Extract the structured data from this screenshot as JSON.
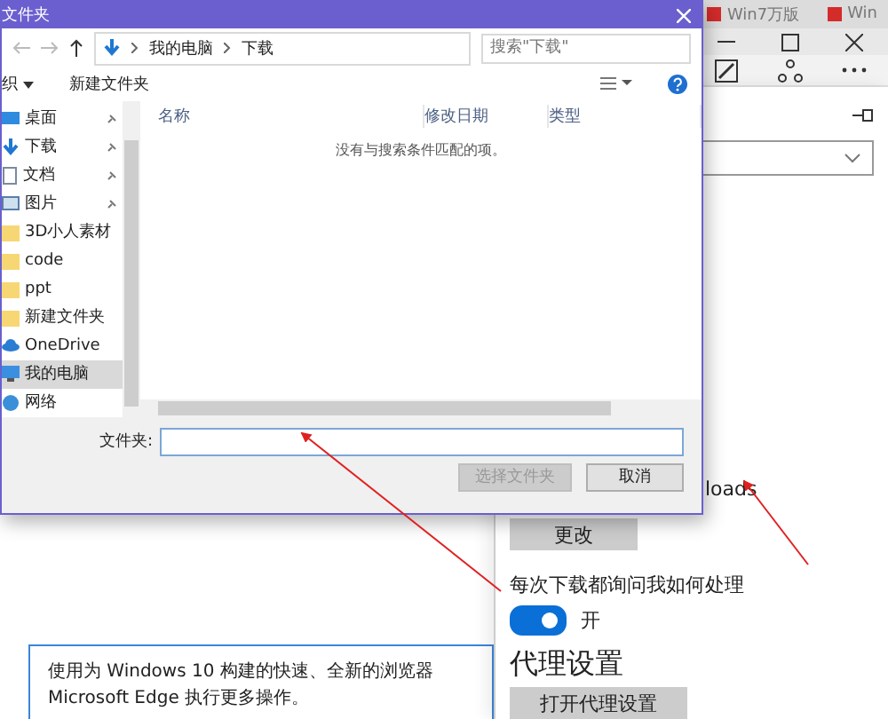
{
  "browser_tabs": [
    {
      "label": "Win7万版"
    },
    {
      "label": "Win"
    }
  ],
  "settings": {
    "path_fragment": "loads",
    "change_button": "更改",
    "ask_label": "每次下载都询问我如何处理",
    "ask_toggle": {
      "on": true,
      "label": "开"
    },
    "proxy_heading": "代理设置",
    "proxy_button": "打开代理设置"
  },
  "banner": "使用为 Windows 10 构建的快速、全新的浏览器 Microsoft Edge 执行更多操作。",
  "dialog": {
    "title": "文件夹",
    "breadcrumb": [
      "我的电脑",
      "下载"
    ],
    "search": {
      "placeholder": "搜索\"下载\""
    },
    "toolbar": {
      "organize": "织",
      "new_folder": "新建文件夹"
    },
    "nav": [
      {
        "label": "桌面",
        "kind": "desktop",
        "pinned": true,
        "selected": false
      },
      {
        "label": "下载",
        "kind": "download",
        "pinned": true,
        "selected": false
      },
      {
        "label": "文档",
        "kind": "document",
        "pinned": true,
        "selected": false
      },
      {
        "label": "图片",
        "kind": "picture",
        "pinned": true,
        "selected": false
      },
      {
        "label": "3D小人素材",
        "kind": "folder",
        "pinned": false,
        "selected": false
      },
      {
        "label": "code",
        "kind": "folder",
        "pinned": false,
        "selected": false
      },
      {
        "label": "ppt",
        "kind": "folder",
        "pinned": false,
        "selected": false
      },
      {
        "label": "新建文件夹",
        "kind": "folder",
        "pinned": false,
        "selected": false
      },
      {
        "label": "OneDrive",
        "kind": "cloud",
        "pinned": false,
        "selected": false
      },
      {
        "label": "我的电脑",
        "kind": "computer",
        "pinned": false,
        "selected": true
      },
      {
        "label": "网络",
        "kind": "network",
        "pinned": false,
        "selected": false
      }
    ],
    "columns": [
      "名称",
      "修改日期",
      "类型"
    ],
    "empty_message": "没有与搜索条件匹配的项。",
    "folder_label": "文件夹:",
    "buttons": [
      {
        "label": "选择文件夹",
        "disabled": true
      },
      {
        "label": "取消",
        "disabled": false
      }
    ]
  }
}
